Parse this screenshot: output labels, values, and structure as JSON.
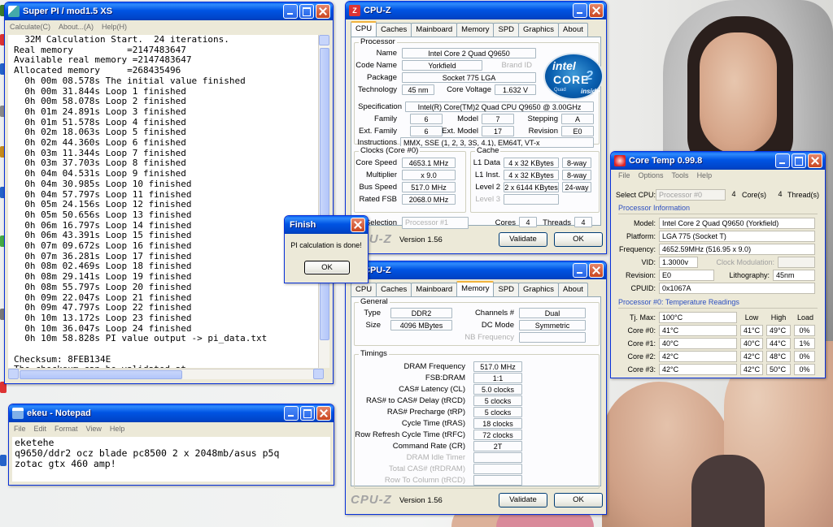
{
  "superpi": {
    "title": "Super PI / mod1.5 XS",
    "menu": [
      "Calculate(C)",
      "About...(A)",
      "Help(H)"
    ],
    "lines": [
      "  32M Calculation Start.  24 iterations.",
      "Real memory          =2147483647",
      "Available real memory =2147483647",
      "Allocated memory     =268435496",
      "  0h 00m 08.578s The initial value finished",
      "  0h 00m 31.844s Loop 1 finished",
      "  0h 00m 58.078s Loop 2 finished",
      "  0h 01m 24.891s Loop 3 finished",
      "  0h 01m 51.578s Loop 4 finished",
      "  0h 02m 18.063s Loop 5 finished",
      "  0h 02m 44.360s Loop 6 finished",
      "  0h 03m 11.344s Loop 7 finished",
      "  0h 03m 37.703s Loop 8 finished",
      "  0h 04m 04.531s Loop 9 finished",
      "  0h 04m 30.985s Loop 10 finished",
      "  0h 04m 57.797s Loop 11 finished",
      "  0h 05m 24.156s Loop 12 finished",
      "  0h 05m 50.656s Loop 13 finished",
      "  0h 06m 16.797s Loop 14 finished",
      "  0h 06m 43.391s Loop 15 finished",
      "  0h 07m 09.672s Loop 16 finished",
      "  0h 07m 36.281s Loop 17 finished",
      "  0h 08m 02.469s Loop 18 finished",
      "  0h 08m 29.141s Loop 19 finished",
      "  0h 08m 55.797s Loop 20 finished",
      "  0h 09m 22.047s Loop 21 finished",
      "  0h 09m 47.797s Loop 22 finished",
      "  0h 10m 13.172s Loop 23 finished",
      "  0h 10m 36.047s Loop 24 finished",
      "  0h 10m 58.828s PI value output -> pi_data.txt",
      "",
      "Checksum: 8FEB134E",
      "The checksum can be validated at"
    ]
  },
  "notepad": {
    "title": "ekeu - Notepad",
    "menu": [
      "File",
      "Edit",
      "Format",
      "View",
      "Help"
    ],
    "lines": [
      "eketehe",
      "q9650/ddr2 ocz blade pc8500 2 x 2048mb/asus p5q",
      "zotac gtx 460 amp!"
    ]
  },
  "finish_dialog": {
    "title": "Finish",
    "message": "PI calculation is done!",
    "ok": "OK"
  },
  "cpuz_cpu": {
    "title": "CPU-Z",
    "tabs": [
      "CPU",
      "Caches",
      "Mainboard",
      "Memory",
      "SPD",
      "Graphics",
      "About"
    ],
    "processor_label": "Processor",
    "name_label": "Name",
    "name": "Intel Core 2 Quad Q9650",
    "codename_label": "Code Name",
    "codename": "Yorkfield",
    "brandid_label": "Brand ID",
    "package_label": "Package",
    "package": "Socket 775 LGA",
    "technology_label": "Technology",
    "technology": "45 nm",
    "corevoltage_label": "Core Voltage",
    "corevoltage": "1.632 V",
    "spec_label": "Specification",
    "spec": "Intel(R) Core(TM)2 Quad CPU   Q9650  @ 3.00GHz",
    "family_label": "Family",
    "family": "6",
    "model_label": "Model",
    "model": "7",
    "stepping_label": "Stepping",
    "stepping": "A",
    "extfamily_label": "Ext. Family",
    "extfamily": "6",
    "extmodel_label": "Ext. Model",
    "extmodel": "17",
    "revision_label": "Revision",
    "revision": "E0",
    "instructions_label": "Instructions",
    "instructions": "MMX, SSE (1, 2, 3, 3S, 4.1), EM64T, VT-x",
    "clocks_label": "Clocks (Core #0)",
    "corespeed_label": "Core Speed",
    "corespeed": "4653.1 MHz",
    "multiplier_label": "Multiplier",
    "multiplier": "x 9.0",
    "busspeed_label": "Bus Speed",
    "busspeed": "517.0 MHz",
    "ratedfsb_label": "Rated FSB",
    "ratedfsb": "2068.0 MHz",
    "cache_label": "Cache",
    "l1data_label": "L1 Data",
    "l1data": "4 x 32 KBytes",
    "l1data_way": "8-way",
    "l1inst_label": "L1 Inst.",
    "l1inst": "4 x 32 KBytes",
    "l1inst_way": "8-way",
    "level2_label": "Level 2",
    "level2": "2 x 6144 KBytes",
    "level2_way": "24-way",
    "level3_label": "Level 3",
    "selection_label": "Selection",
    "selection": "Processor #1",
    "cores_label": "Cores",
    "cores": "4",
    "threads_label": "Threads",
    "threads": "4",
    "logo": "CPU-Z",
    "version": "Version 1.56",
    "validate": "Validate",
    "ok": "OK",
    "intel_logo": {
      "brand": "intel",
      "line1": "CORE",
      "line2": "Quad",
      "line3": "inside",
      "sup": "2"
    }
  },
  "cpuz_mem": {
    "title": "CPU-Z",
    "tabs": [
      "CPU",
      "Caches",
      "Mainboard",
      "Memory",
      "SPD",
      "Graphics",
      "About"
    ],
    "general_label": "General",
    "type_label": "Type",
    "type": "DDR2",
    "size_label": "Size",
    "size": "4096 MBytes",
    "channels_label": "Channels #",
    "channels": "Dual",
    "dcmode_label": "DC Mode",
    "dcmode": "Symmetric",
    "nbfreq_label": "NB Frequency",
    "timings_label": "Timings",
    "dramfreq_label": "DRAM Frequency",
    "dramfreq": "517.0 MHz",
    "fsbdram_label": "FSB:DRAM",
    "fsbdram": "1:1",
    "cas_label": "CAS# Latency (CL)",
    "cas": "5.0 clocks",
    "trcd_label": "RAS# to CAS# Delay (tRCD)",
    "trcd": "5 clocks",
    "trp_label": "RAS# Precharge (tRP)",
    "trp": "5 clocks",
    "tras_label": "Cycle Time (tRAS)",
    "tras": "18 clocks",
    "trfc_label": "Row Refresh Cycle Time (tRFC)",
    "trfc": "72 clocks",
    "cr_label": "Command Rate (CR)",
    "cr": "2T",
    "idle_label": "DRAM Idle Timer",
    "totalcas_label": "Total CAS# (tRDRAM)",
    "rowcol_label": "Row To Column (tRCD)",
    "logo": "CPU-Z",
    "version": "Version 1.56",
    "validate": "Validate",
    "ok": "OK"
  },
  "coretemp": {
    "title": "Core Temp 0.99.8",
    "menu": [
      "File",
      "Options",
      "Tools",
      "Help"
    ],
    "selectcpu_label": "Select CPU:",
    "selectcpu": "Processor #0",
    "cores": "4",
    "cores_label": "Core(s)",
    "threads": "4",
    "threads_label": "Thread(s)",
    "procinfo_label": "Processor Information",
    "model_label": "Model:",
    "model": "Intel Core 2 Quad Q9650 (Yorkfield)",
    "platform_label": "Platform:",
    "platform": "LGA 775 (Socket T)",
    "frequency_label": "Frequency:",
    "frequency": "4652.59MHz (516.95 x 9.0)",
    "vid_label": "VID:",
    "vid": "1.3000v",
    "clockmod_label": "Clock Modulation:",
    "revision_label": "Revision:",
    "revision": "E0",
    "litho_label": "Lithography:",
    "litho": "45nm",
    "cpuid_label": "CPUID:",
    "cpuid": "0x1067A",
    "temps_label": "Processor #0: Temperature Readings",
    "tjmax_label": "Tj. Max:",
    "tjmax": "100°C",
    "low_label": "Low",
    "high_label": "High",
    "load_label": "Load",
    "rows": [
      {
        "name": "Core #0:",
        "temp": "41°C",
        "low": "41°C",
        "high": "49°C",
        "load": "0%"
      },
      {
        "name": "Core #1:",
        "temp": "40°C",
        "low": "40°C",
        "high": "44°C",
        "load": "1%"
      },
      {
        "name": "Core #2:",
        "temp": "42°C",
        "low": "42°C",
        "high": "48°C",
        "load": "0%"
      },
      {
        "name": "Core #3:",
        "temp": "42°C",
        "low": "42°C",
        "high": "50°C",
        "load": "0%"
      }
    ]
  }
}
